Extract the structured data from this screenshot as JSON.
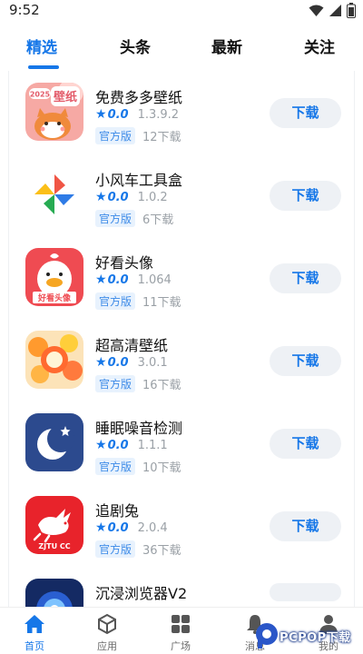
{
  "status_bar": {
    "time": "9:52"
  },
  "tabs": [
    {
      "label": "精选",
      "active": true
    },
    {
      "label": "头条",
      "active": false
    },
    {
      "label": "最新",
      "active": false
    },
    {
      "label": "关注",
      "active": false
    }
  ],
  "apps": [
    {
      "name": "免费多多壁纸",
      "rating": "0.0",
      "version": "1.3.9.2",
      "badge": "官方版",
      "downloads": "12下载",
      "download_label": "下载",
      "icon": "cat-wallpaper-icon"
    },
    {
      "name": "小风车工具盒",
      "rating": "0.0",
      "version": "1.0.2",
      "badge": "官方版",
      "downloads": "6下载",
      "download_label": "下载",
      "icon": "pinwheel-icon"
    },
    {
      "name": "好看头像",
      "rating": "0.0",
      "version": "1.064",
      "badge": "官方版",
      "downloads": "11下载",
      "download_label": "下载",
      "icon": "duck-avatar-icon"
    },
    {
      "name": "超高清壁纸",
      "rating": "0.0",
      "version": "3.0.1",
      "badge": "官方版",
      "downloads": "16下载",
      "download_label": "下载",
      "icon": "colorful-circles-icon"
    },
    {
      "name": "睡眠噪音检测",
      "rating": "0.0",
      "version": "1.1.1",
      "badge": "官方版",
      "downloads": "10下载",
      "download_label": "下载",
      "icon": "moon-icon"
    },
    {
      "name": "追剧兔",
      "rating": "0.0",
      "version": "2.0.4",
      "badge": "官方版",
      "downloads": "36下载",
      "download_label": "下载",
      "icon": "rabbit-icon"
    },
    {
      "name": "沉浸浏览器V2",
      "rating": "",
      "version": "",
      "badge": "",
      "downloads": "",
      "download_label": "",
      "icon": "browser-icon"
    }
  ],
  "icon_texts": {
    "cat_year": "2025",
    "cat_label": "壁纸",
    "duck_label": "好看头像",
    "rabbit_label": "ZJTU CC"
  },
  "bottom_nav": [
    {
      "label": "首页",
      "icon": "home-icon",
      "active": true
    },
    {
      "label": "应用",
      "icon": "box-icon",
      "active": false
    },
    {
      "label": "广场",
      "icon": "grid-icon",
      "active": false
    },
    {
      "label": "消息",
      "icon": "bell-icon",
      "active": false
    },
    {
      "label": "我的",
      "icon": "person-icon",
      "active": false
    }
  ],
  "watermark": {
    "text": "PCPOP下载"
  },
  "colors": {
    "accent": "#1677e8",
    "badge_bg": "#e8f2fd",
    "button_bg": "#eef1f5",
    "muted": "#9aa0a6"
  }
}
